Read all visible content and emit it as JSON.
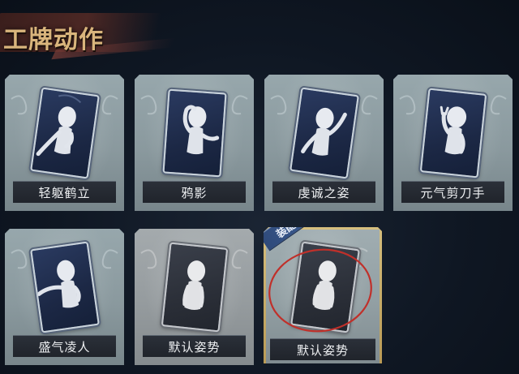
{
  "header": {
    "title": "工牌动作"
  },
  "cards": [
    {
      "label": "轻躯鹤立",
      "pose": "crane"
    },
    {
      "label": "鸦影",
      "pose": "crow"
    },
    {
      "label": "虔诚之姿",
      "pose": "devout"
    },
    {
      "label": "元气剪刀手",
      "pose": "peace"
    },
    {
      "label": "盛气凌人",
      "pose": "arrogant"
    },
    {
      "label": "默认姿势",
      "pose": "default"
    },
    {
      "label": "默认姿势",
      "pose": "default",
      "equipped": true,
      "badge": "装配"
    }
  ],
  "colors": {
    "title": "#d9b57c",
    "equipped_frame": "#c9ab62",
    "badge": "#3b5c92",
    "annotation_circle": "#c0302a"
  }
}
